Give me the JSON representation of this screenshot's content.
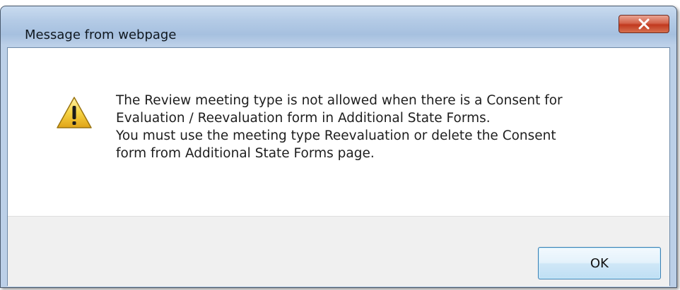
{
  "window": {
    "title": "Message from webpage",
    "close_label": "X"
  },
  "message": {
    "lines": [
      "The Review meeting type is not allowed when there is a Consent for",
      "Evaluation / Reevaluation form in Additional State Forms.",
      "You must use the meeting type Reevaluation or delete the Consent",
      "form from Additional State Forms page."
    ],
    "icon": "warning-icon"
  },
  "buttons": {
    "ok_label": "OK"
  },
  "colors": {
    "title_bar": "#b4cbe6",
    "close_button": "#c1391f",
    "footer": "#f0f0f0",
    "warning_yellow": "#f4c430"
  }
}
